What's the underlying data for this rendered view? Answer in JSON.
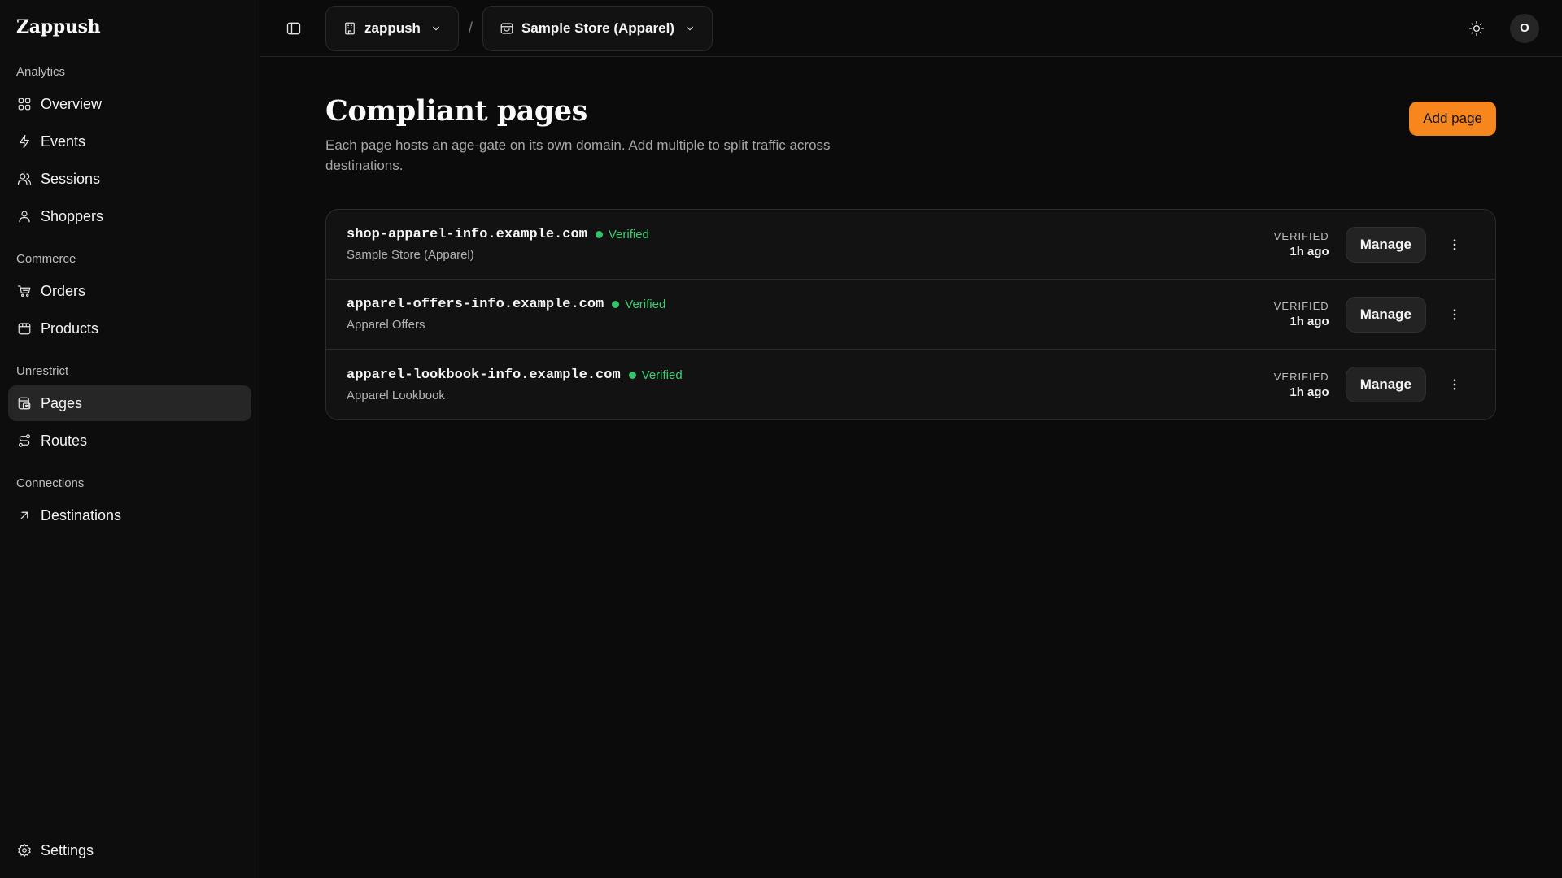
{
  "brand": "Zappush",
  "sidebar": {
    "sections": [
      {
        "label": "Analytics",
        "items": [
          {
            "label": "Overview",
            "icon": "grid-icon"
          },
          {
            "label": "Events",
            "icon": "bolt-icon"
          },
          {
            "label": "Sessions",
            "icon": "users-icon"
          },
          {
            "label": "Shoppers",
            "icon": "user-icon"
          }
        ]
      },
      {
        "label": "Commerce",
        "items": [
          {
            "label": "Orders",
            "icon": "cart-icon"
          },
          {
            "label": "Products",
            "icon": "box-icon"
          }
        ]
      },
      {
        "label": "Unrestrict",
        "items": [
          {
            "label": "Pages",
            "icon": "pages-icon",
            "active": true
          },
          {
            "label": "Routes",
            "icon": "routes-icon"
          }
        ]
      },
      {
        "label": "Connections",
        "items": [
          {
            "label": "Destinations",
            "icon": "arrow-up-right-icon"
          }
        ]
      }
    ],
    "settings_label": "Settings"
  },
  "topbar": {
    "org": "zappush",
    "separator": "/",
    "store": "Sample Store (Apparel)",
    "avatar_initial": "O"
  },
  "page": {
    "title": "Compliant pages",
    "description": "Each page hosts an age-gate on its own domain. Add multiple to split traffic across destinations.",
    "add_button": "Add page"
  },
  "pages": [
    {
      "domain": "shop-apparel-info.example.com",
      "status": "Verified",
      "name": "Sample Store (Apparel)",
      "meta_label": "VERIFIED",
      "meta_time": "1h ago",
      "manage": "Manage"
    },
    {
      "domain": "apparel-offers-info.example.com",
      "status": "Verified",
      "name": "Apparel Offers",
      "meta_label": "VERIFIED",
      "meta_time": "1h ago",
      "manage": "Manage"
    },
    {
      "domain": "apparel-lookbook-info.example.com",
      "status": "Verified",
      "name": "Apparel Lookbook",
      "meta_label": "VERIFIED",
      "meta_time": "1h ago",
      "manage": "Manage"
    }
  ],
  "colors": {
    "accent": "#f7861c",
    "verified": "#34c36b",
    "background": "#0b0b0b"
  }
}
